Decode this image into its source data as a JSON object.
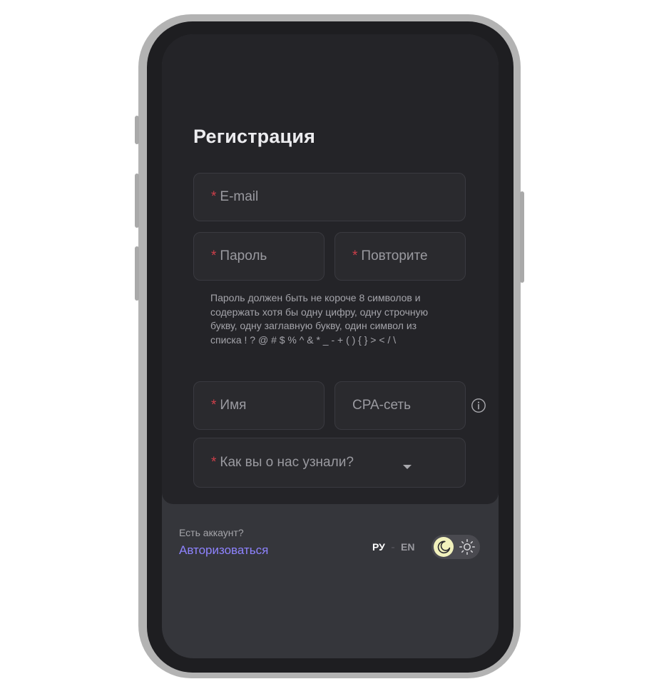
{
  "registration": {
    "title": "Регистрация",
    "required_mark": "*",
    "email_label": "E-mail",
    "password_label": "Пароль",
    "repeat_label": "Повторите",
    "password_hint": "Пароль должен быть не короче 8 символов и содержать хотя бы одну цифру, одну строчную букву, одну заглавную букву, один символ из списка ! ? @ # $ % ^ & * _ - + ( ) { } > < / \\",
    "name_label": "Имя",
    "cpa_label": "CPA-сеть",
    "source_label": "Как вы о нас узнали?"
  },
  "footer": {
    "account_question": "Есть аккаунт?",
    "login_link": "Авторизоваться",
    "lang_ru": "РУ",
    "lang_en": "EN",
    "theme": "dark"
  },
  "icons": {
    "info": "info-icon",
    "caret": "caret-down-icon",
    "moon": "moon-icon",
    "sun": "sun-icon"
  },
  "colors": {
    "accent": "#8e83ff",
    "required": "#cf3f4a",
    "card_background": "#242428",
    "footer_background": "#35363b",
    "moon_knob": "#f1f1bc"
  }
}
